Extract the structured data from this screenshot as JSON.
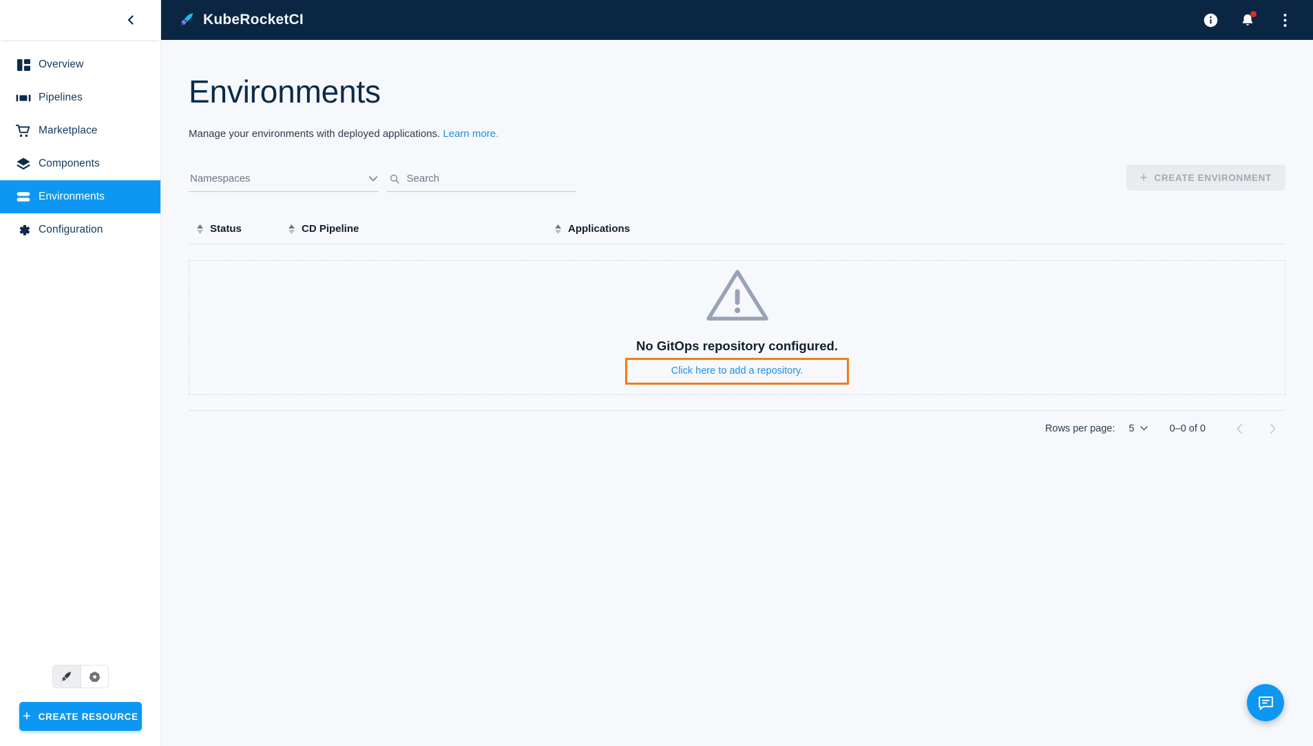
{
  "header": {
    "brand": "KubeRocketCI",
    "icons": {
      "info": "info-icon",
      "notifications": "bell-icon",
      "overflow": "kebab-menu-icon"
    }
  },
  "sidebar": {
    "collapse_icon": "chevron-left-icon",
    "items": [
      {
        "label": "Overview",
        "icon": "dashboard-icon",
        "active": false
      },
      {
        "label": "Pipelines",
        "icon": "pipelines-icon",
        "active": false
      },
      {
        "label": "Marketplace",
        "icon": "cart-icon",
        "active": false
      },
      {
        "label": "Components",
        "icon": "layers-icon",
        "active": false
      },
      {
        "label": "Environments",
        "icon": "environments-icon",
        "active": true
      },
      {
        "label": "Configuration",
        "icon": "gear-icon",
        "active": false
      }
    ],
    "footer": {
      "toggles": [
        {
          "name": "kuberocket-view-toggle",
          "icon": "rocket-icon",
          "selected": true
        },
        {
          "name": "kubernetes-view-toggle",
          "icon": "kubernetes-icon",
          "selected": false
        }
      ],
      "create_resource_label": "CREATE RESOURCE"
    }
  },
  "main": {
    "title": "Environments",
    "description": "Manage your environments with deployed applications.",
    "learn_more": "Learn more.",
    "filters": {
      "namespaces_label": "Namespaces",
      "search_placeholder": "Search",
      "search_value": ""
    },
    "create_environment_label": "CREATE ENVIRONMENT",
    "create_environment_disabled": true,
    "table": {
      "columns": [
        {
          "label": "Status"
        },
        {
          "label": "CD Pipeline"
        },
        {
          "label": "Applications"
        }
      ],
      "rows": []
    },
    "empty_state": {
      "icon": "warning-triangle-icon",
      "title": "No GitOps repository configured.",
      "link": "Click here to add a repository.",
      "highlight_color": "#f07c14"
    },
    "pagination": {
      "rows_per_page_label": "Rows per page:",
      "rows_per_page_value": "5",
      "range_label": "0–0 of 0",
      "prev_icon": "chevron-left-icon",
      "next_icon": "chevron-right-icon"
    }
  },
  "fab": {
    "icon": "chat-icon"
  },
  "colors": {
    "accent": "#0e97f2",
    "header_bg": "#0a2642",
    "page_bg": "#f6f8fc",
    "link": "#1f8fe0",
    "highlight": "#f07c14",
    "badge": "#e02b26"
  }
}
